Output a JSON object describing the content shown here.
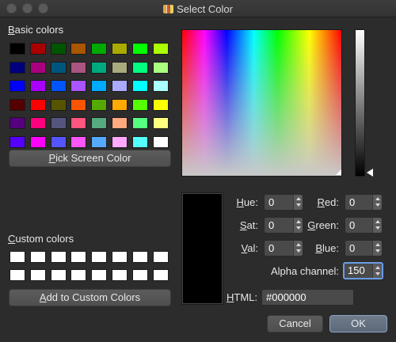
{
  "window": {
    "title": "Select Color"
  },
  "basic_colors": {
    "label": "asic colors",
    "label_accel": "B",
    "swatches": [
      [
        "#000000",
        "#aa0000",
        "#005500",
        "#aa5500",
        "#00aa00",
        "#aaaa00",
        "#00ff00",
        "#aaff00"
      ],
      [
        "#00007f",
        "#aa007f",
        "#00557f",
        "#aa557f",
        "#00aa7f",
        "#aaaa7f",
        "#00ff7f",
        "#aaff7f"
      ],
      [
        "#0000ff",
        "#aa00ff",
        "#0055ff",
        "#aa55ff",
        "#00aaff",
        "#aaaaff",
        "#00ffff",
        "#aaffff"
      ],
      [
        "#550000",
        "#ff0000",
        "#555500",
        "#ff5500",
        "#55aa00",
        "#ffaa00",
        "#55ff00",
        "#ffff00"
      ],
      [
        "#55007f",
        "#ff007f",
        "#55557f",
        "#ff557f",
        "#55aa7f",
        "#ffaa7f",
        "#55ff7f",
        "#ffff7f"
      ],
      [
        "#5500ff",
        "#ff00ff",
        "#5555ff",
        "#ff55ff",
        "#55aaff",
        "#ffaaff",
        "#55ffff",
        "#ffffff"
      ]
    ]
  },
  "pick_screen_color": {
    "accel": "P",
    "label": "ick Screen Color"
  },
  "custom_colors": {
    "label": "ustom colors",
    "label_accel": "C",
    "rows": 2,
    "cols": 8,
    "color": "#ffffff"
  },
  "add_to_custom": {
    "accel": "A",
    "label": "dd to Custom Colors"
  },
  "fields": {
    "hue": {
      "accel": "H",
      "label": "ue:",
      "value": "0"
    },
    "sat": {
      "accel": "S",
      "label": "at:",
      "value": "0"
    },
    "val": {
      "accel": "V",
      "label": "al:",
      "value": "0"
    },
    "red": {
      "accel": "R",
      "label": "ed:",
      "value": "0"
    },
    "green": {
      "accel": "G",
      "label": "reen:",
      "value": "0"
    },
    "blue": {
      "accel": "B",
      "label": "lue:",
      "value": "0"
    },
    "alpha": {
      "label": "Alpha channel:",
      "value": "150"
    },
    "html": {
      "accel": "H",
      "label": "TML:",
      "value": "#000000"
    }
  },
  "buttons": {
    "cancel": "Cancel",
    "ok": "OK"
  },
  "colors": {
    "current": "#000000"
  }
}
